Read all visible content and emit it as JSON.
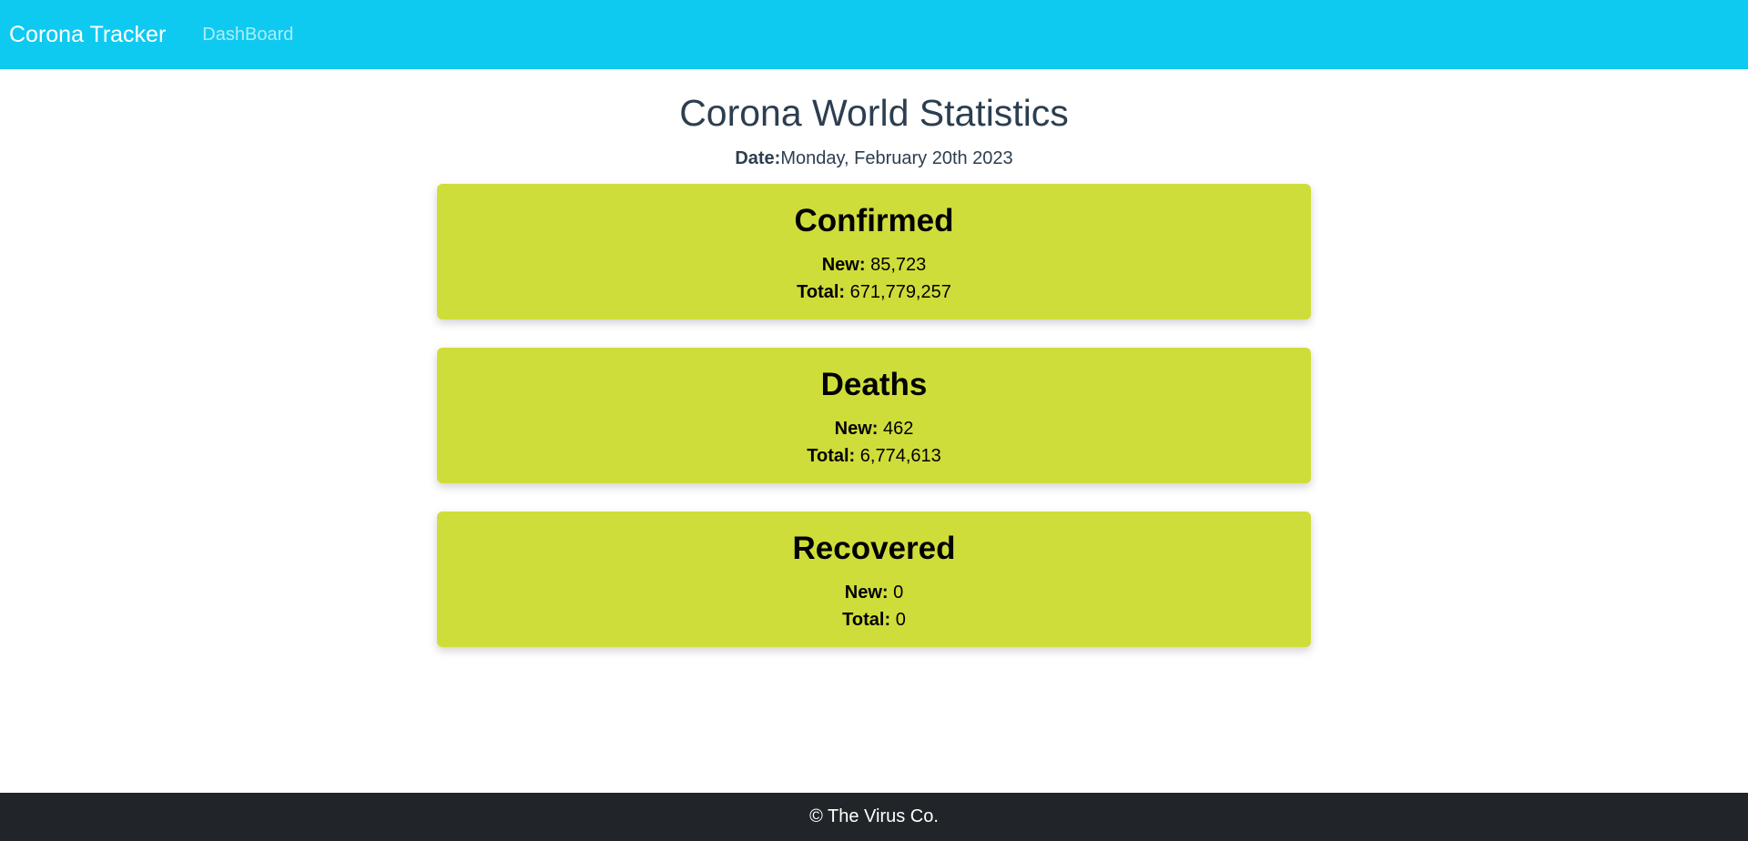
{
  "navbar": {
    "brand": "Corona Tracker",
    "links": [
      "DashBoard"
    ]
  },
  "main": {
    "title": "Corona World Statistics",
    "date_label": "Date:",
    "date_value": "Monday, February 20th 2023"
  },
  "cards": [
    {
      "title": "Confirmed",
      "new_label": "New:",
      "new_value": "85,723",
      "total_label": "Total:",
      "total_value": "671,779,257"
    },
    {
      "title": "Deaths",
      "new_label": "New:",
      "new_value": "462",
      "total_label": "Total:",
      "total_value": "6,774,613"
    },
    {
      "title": "Recovered",
      "new_label": "New:",
      "new_value": "0",
      "total_label": "Total:",
      "total_value": "0"
    }
  ],
  "footer": {
    "text": "© The Virus Co."
  },
  "colors": {
    "navbar": "#0fcaf0",
    "card": "#cfdd3a",
    "footer": "#212529",
    "heading": "#2c3e50"
  }
}
